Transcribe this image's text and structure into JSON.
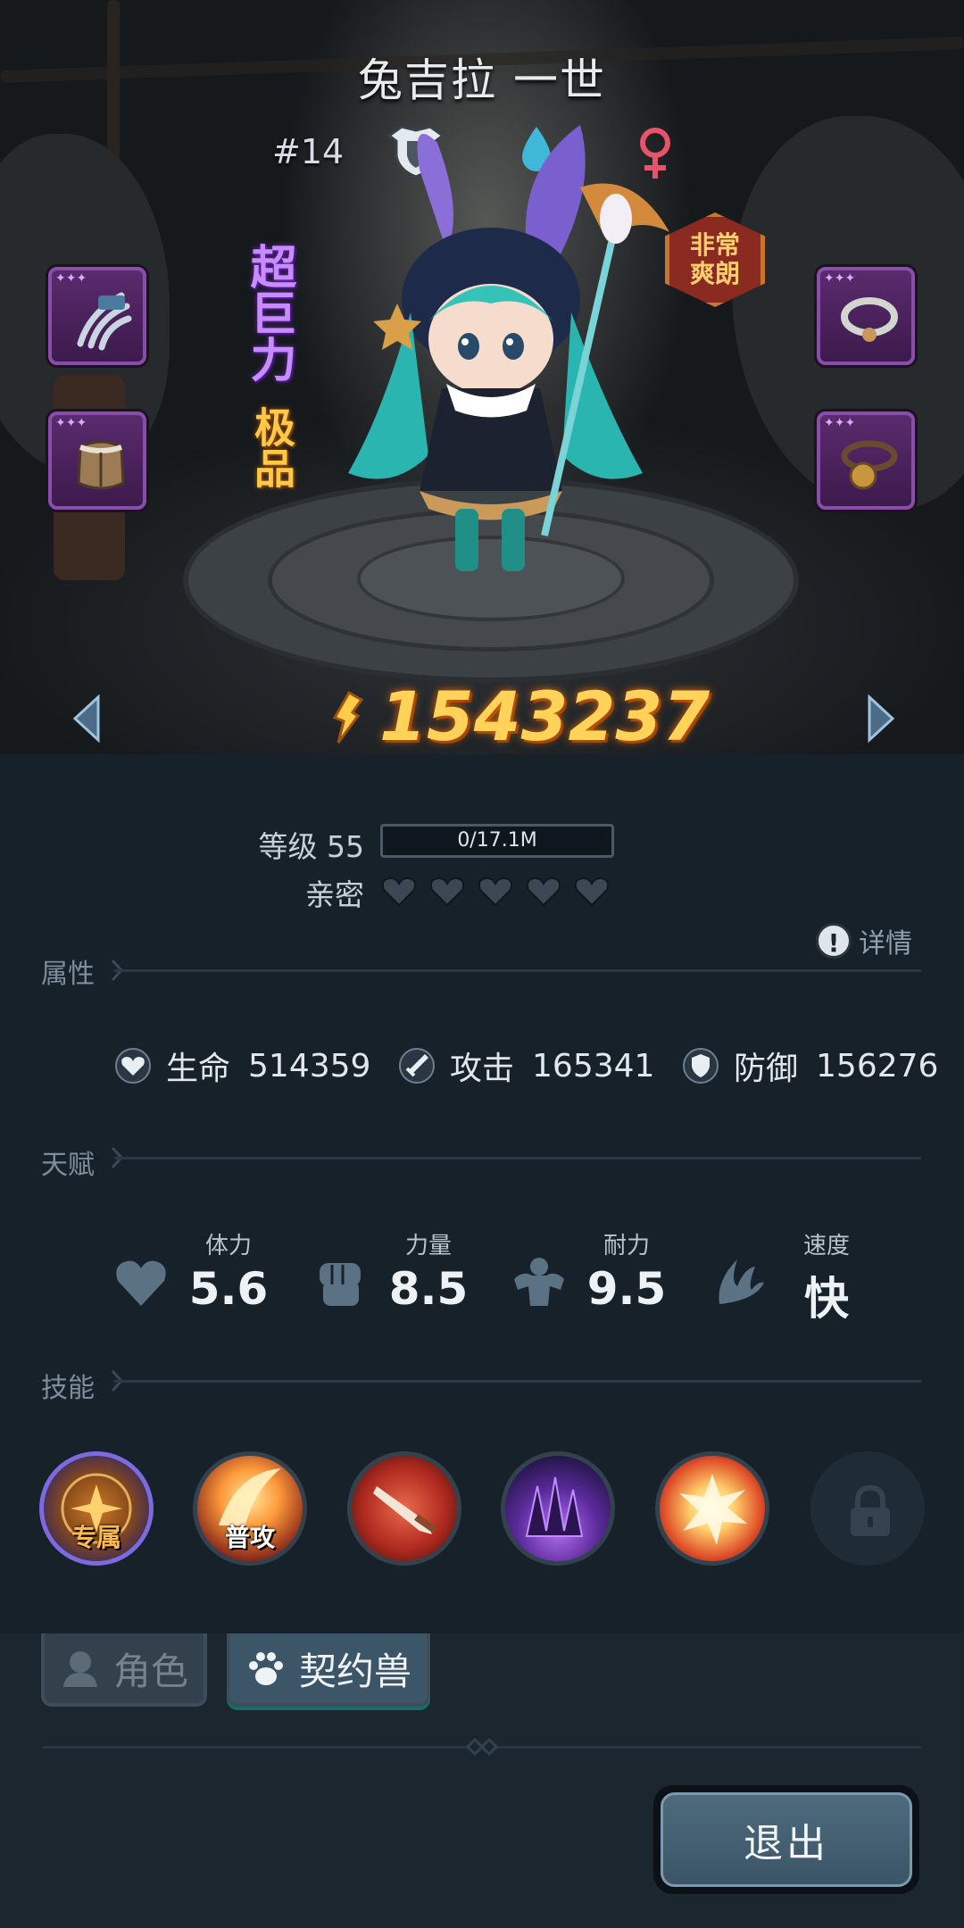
{
  "hero": {
    "name": "兔吉拉 一世",
    "rank": "#14",
    "trait_badge": "非常爽朗",
    "tag_1": "超巨力",
    "tag_2": "极品",
    "combat_power": "1543237"
  },
  "progress": {
    "level_label": "等级 55",
    "xp_text": "0/17.1M",
    "xp_fraction": 0,
    "affection_label": "亲密",
    "affection_hearts_filled": 0,
    "affection_hearts_total": 5
  },
  "detail_label": "详情",
  "attributes": {
    "header": "属性",
    "hp_label": "生命",
    "hp_value": "514359",
    "atk_label": "攻击",
    "atk_value": "165341",
    "def_label": "防御",
    "def_value": "156276"
  },
  "talents": {
    "header": "天赋",
    "items": [
      {
        "label": "体力",
        "value": "5.6",
        "icon": "heart-icon"
      },
      {
        "label": "力量",
        "value": "8.5",
        "icon": "fist-icon"
      },
      {
        "label": "耐力",
        "value": "9.5",
        "icon": "muscle-icon"
      },
      {
        "label": "速度",
        "value": "快",
        "icon": "wing-icon"
      }
    ]
  },
  "skills": {
    "header": "技能",
    "items": [
      {
        "caption": "专属",
        "icon": "exclusive-skill-icon"
      },
      {
        "caption": "普攻",
        "icon": "normal-attack-icon"
      },
      {
        "caption": "",
        "icon": "sword-slash-icon"
      },
      {
        "caption": "",
        "icon": "dark-spikes-icon"
      },
      {
        "caption": "",
        "icon": "explosion-icon"
      },
      {
        "caption": "",
        "icon": "lock-icon"
      }
    ]
  },
  "tabs": {
    "character": "角色",
    "pet": "契约兽"
  },
  "exit_label": "退出",
  "colors": {
    "power": "#ffd25a",
    "panel_bg": "#17212a",
    "equip_slot": "#5a2b6d",
    "female": "#e8536a"
  }
}
